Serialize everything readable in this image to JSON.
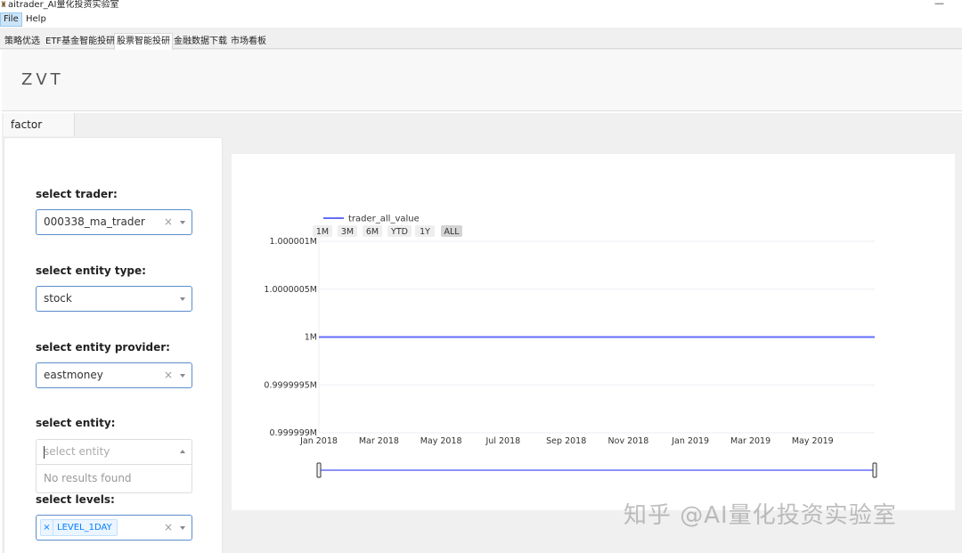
{
  "window": {
    "title": "aitrader_AI量化投资实验室",
    "minimize_glyph": "—"
  },
  "menu": {
    "file": "File",
    "help": "Help"
  },
  "tabs": [
    {
      "label": "策略优选"
    },
    {
      "label": "ETF基金智能投研"
    },
    {
      "label": "股票智能投研"
    },
    {
      "label": "金融数据下载"
    },
    {
      "label": "市场看板"
    }
  ],
  "active_tab_index": 2,
  "brand": "ZVT",
  "subtab": "factor",
  "form": {
    "trader": {
      "label": "select trader:",
      "value": "000338_ma_trader",
      "clear": "×"
    },
    "entity_type": {
      "label": "select entity type:",
      "value": "stock"
    },
    "entity_provider": {
      "label": "select entity provider:",
      "value": "eastmoney",
      "clear": "×"
    },
    "entity": {
      "label": "select entity:",
      "placeholder": "select entity",
      "no_results": "No results found"
    },
    "levels": {
      "label": "select levels:",
      "tag": "LEVEL_1DAY",
      "tag_remove": "×",
      "clear": "×"
    }
  },
  "chart_data": {
    "type": "line",
    "series": [
      {
        "name": "trader_all_value",
        "color": "#636efa",
        "x": [
          "2018-01-01",
          "2019-07-01"
        ],
        "y": [
          1000000,
          1000000
        ]
      }
    ],
    "range_buttons": [
      "1M",
      "3M",
      "6M",
      "YTD",
      "1Y",
      "ALL"
    ],
    "active_range": "ALL",
    "x_ticks": [
      "Jan 2018",
      "Mar 2018",
      "May 2018",
      "Jul 2018",
      "Sep 2018",
      "Nov 2018",
      "Jan 2019",
      "Mar 2019",
      "May 2019"
    ],
    "y_ticks": [
      "1.000001M",
      "1.0000005M",
      "1M",
      "0.9999995M",
      "0.999999M"
    ],
    "ylim": [
      999999,
      1000001
    ],
    "legend": "top-left",
    "range_slider": true
  },
  "watermark": "知乎 @AI量化投资实验室"
}
